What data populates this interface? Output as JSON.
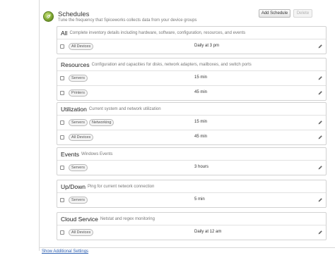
{
  "header": {
    "title": "Schedules",
    "subtitle": "Tune the frequency that Spiceworks collects data from your device groups",
    "add_button": "Add Schedule",
    "delete_button": "Delete"
  },
  "cards": [
    {
      "name": "All",
      "description": "Complete inventory details including hardware, software, configuration, resources, and events",
      "rows": [
        {
          "tags": [
            "All Devices"
          ],
          "frequency": "Daily at 3 pm"
        }
      ]
    },
    {
      "name": "Resources",
      "description": "Configuration and capacities for disks, network adapters, mailboxes, and switch ports",
      "rows": [
        {
          "tags": [
            "Servers"
          ],
          "frequency": "15 min"
        },
        {
          "tags": [
            "Printers"
          ],
          "frequency": "45 min"
        }
      ]
    },
    {
      "name": "Utilization",
      "description": "Current system and network utilization",
      "rows": [
        {
          "tags": [
            "Servers",
            "Networking"
          ],
          "frequency": "15 min"
        },
        {
          "tags": [
            "All Devices"
          ],
          "frequency": "45 min"
        }
      ]
    },
    {
      "name": "Events",
      "description": "Windows Events",
      "rows": [
        {
          "tags": [
            "Servers"
          ],
          "frequency": "3 hours"
        }
      ]
    },
    {
      "name": "Up/Down",
      "description": "Ping for current network connection",
      "rows": [
        {
          "tags": [
            "Servers"
          ],
          "frequency": "5 min"
        }
      ]
    },
    {
      "name": "Cloud Service",
      "description": "Netstat and regex monitoring",
      "rows": [
        {
          "tags": [
            "All Devices"
          ],
          "frequency": "Daily at 12 am"
        }
      ]
    }
  ],
  "footer": {
    "link": "Show Additional Settings"
  },
  "icons": {
    "logo": "spiceworks-leaf-icon",
    "edit": "pencil-icon",
    "checkbox": "checkbox-icon"
  },
  "colors": {
    "link": "#2a5db0",
    "logo_green": "#7fa832"
  }
}
